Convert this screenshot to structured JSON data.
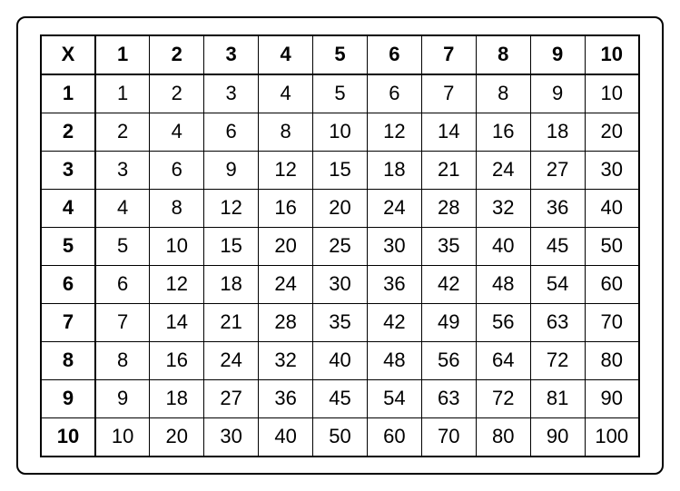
{
  "chart_data": {
    "type": "table",
    "title": "",
    "corner_label": "X",
    "col_headers": [
      "1",
      "2",
      "3",
      "4",
      "5",
      "6",
      "7",
      "8",
      "9",
      "10"
    ],
    "row_headers": [
      "1",
      "2",
      "3",
      "4",
      "5",
      "6",
      "7",
      "8",
      "9",
      "10"
    ],
    "values": [
      [
        "1",
        "2",
        "3",
        "4",
        "5",
        "6",
        "7",
        "8",
        "9",
        "10"
      ],
      [
        "2",
        "4",
        "6",
        "8",
        "10",
        "12",
        "14",
        "16",
        "18",
        "20"
      ],
      [
        "3",
        "6",
        "9",
        "12",
        "15",
        "18",
        "21",
        "24",
        "27",
        "30"
      ],
      [
        "4",
        "8",
        "12",
        "16",
        "20",
        "24",
        "28",
        "32",
        "36",
        "40"
      ],
      [
        "5",
        "10",
        "15",
        "20",
        "25",
        "30",
        "35",
        "40",
        "45",
        "50"
      ],
      [
        "6",
        "12",
        "18",
        "24",
        "30",
        "36",
        "42",
        "48",
        "54",
        "60"
      ],
      [
        "7",
        "14",
        "21",
        "28",
        "35",
        "42",
        "49",
        "56",
        "63",
        "70"
      ],
      [
        "8",
        "16",
        "24",
        "32",
        "40",
        "48",
        "56",
        "64",
        "72",
        "80"
      ],
      [
        "9",
        "18",
        "27",
        "36",
        "45",
        "54",
        "63",
        "72",
        "81",
        "90"
      ],
      [
        "10",
        "20",
        "30",
        "40",
        "50",
        "60",
        "70",
        "80",
        "90",
        "100"
      ]
    ]
  }
}
